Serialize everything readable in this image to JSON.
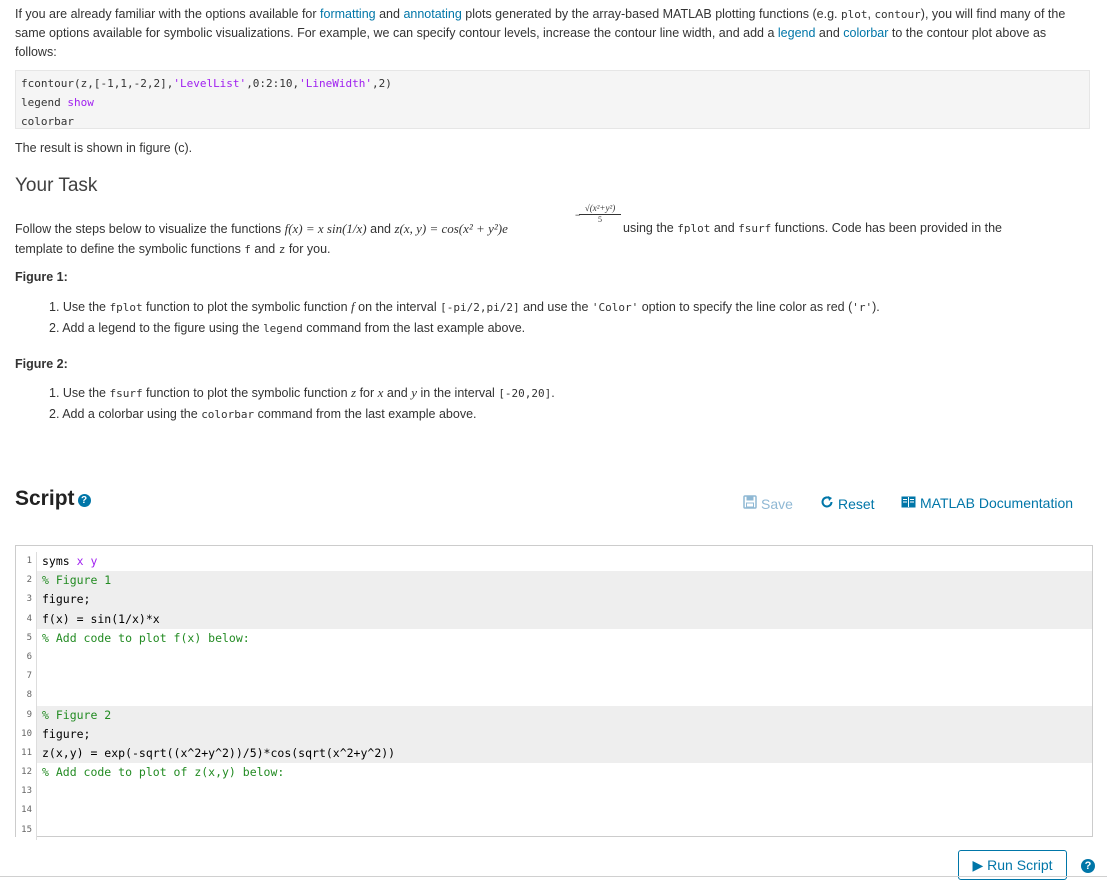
{
  "intro": {
    "p1_a": "If you are already familiar with the options available for ",
    "link_formatting": "formatting",
    "p1_b": " and ",
    "link_annotating": "annotating",
    "p1_c": " plots generated by the array-based MATLAB plotting functions (e.g. ",
    "code_plot": "plot",
    "p1_d": ", ",
    "code_contour": "contour",
    "p1_e": "), you will find many of the same options available for symbolic visualizations. For example, we can specify contour levels, increase the contour line width, and add a ",
    "link_legend": "legend",
    "p1_f": " and ",
    "link_colorbar": "colorbar",
    "p1_g": " to the contour plot above as follows:",
    "code_line1_a": "fcontour(z,[-1,1,-2,2],",
    "code_line1_s1": "'LevelList'",
    "code_line1_b": ",0:2:10,",
    "code_line1_s2": "'LineWidth'",
    "code_line1_c": ",2)",
    "code_line2_a": "legend ",
    "code_line2_b": "show",
    "code_line3": "colorbar",
    "result_text": "The result is shown in figure (c)."
  },
  "task": {
    "heading": "Your Task",
    "follow_a": "Follow the steps below to visualize the functions ",
    "f_def": "f(x) = x sin(1/x)",
    "follow_and": " and ",
    "z_def_a": "z(x, y) = cos(x² + y²)e",
    "z_exp_num": "√(x²+y²)",
    "z_exp_den": "5",
    "follow_b": " using the ",
    "code_fplot": "fplot",
    "follow_c": " and ",
    "code_fsurf": "fsurf",
    "follow_d": " functions. Code has been provided in the",
    "follow_e": "template to define the symbolic functions ",
    "code_f": "f",
    "follow_f": " and ",
    "code_z": "z",
    "follow_g": " for you."
  },
  "figure1": {
    "heading": "Figure 1:",
    "s1_a": "1. Use the ",
    "s1_code1": "fplot",
    "s1_b": " function to plot the symbolic function ",
    "s1_f": "f",
    "s1_c": " on the interval ",
    "s1_code2": "[-pi/2,pi/2]",
    "s1_d": " and use the ",
    "s1_code3": "'Color'",
    "s1_e": " option to specify the line color as red (",
    "s1_code4": "'r'",
    "s1_f2": ").",
    "s2_a": "2. Add a legend to the figure using the ",
    "s2_code": "legend",
    "s2_b": " command from the last example above."
  },
  "figure2": {
    "heading": "Figure 2:",
    "s1_a": "1. Use the ",
    "s1_code1": "fsurf",
    "s1_b": " function to plot the symbolic function ",
    "s1_z": "z",
    "s1_c": " for ",
    "s1_x": "x",
    "s1_d": " and ",
    "s1_y": "y",
    "s1_e": " in the interval ",
    "s1_code2": "[-20,20]",
    "s1_f": ".",
    "s2_a": "2. Add a colorbar using the ",
    "s2_code": "colorbar",
    "s2_b": " command from the last example above."
  },
  "script": {
    "title": "Script",
    "save_label": "Save",
    "reset_label": "Reset",
    "docs_label": "MATLAB Documentation",
    "run_label": "Run Script",
    "lines": [
      {
        "n": "1",
        "a": "syms ",
        "b": "x y",
        "shaded": false
      },
      {
        "n": "2",
        "cmt": "% Figure 1",
        "shaded": true
      },
      {
        "n": "3",
        "a": "figure;",
        "shaded": true
      },
      {
        "n": "4",
        "a": "f(x) = sin(1/x)*x",
        "shaded": true
      },
      {
        "n": "5",
        "cmt": "% Add code to plot f(x) below:",
        "shaded": false
      },
      {
        "n": "6",
        "a": "",
        "shaded": false
      },
      {
        "n": "7",
        "a": "",
        "shaded": false
      },
      {
        "n": "8",
        "a": "",
        "shaded": false
      },
      {
        "n": "9",
        "cmt": "% Figure 2",
        "shaded": true
      },
      {
        "n": "10",
        "a": "figure;",
        "shaded": true
      },
      {
        "n": "11",
        "a": "z(x,y) = exp(-sqrt((x^2+y^2))/5)*cos(sqrt(x^2+y^2))",
        "shaded": true
      },
      {
        "n": "12",
        "cmt": "% Add code to plot of z(x,y) below:",
        "shaded": false
      },
      {
        "n": "13",
        "a": "",
        "shaded": false
      },
      {
        "n": "14",
        "a": "",
        "shaded": false
      },
      {
        "n": "15",
        "a": "",
        "shaded": false
      }
    ]
  },
  "icons": {
    "help": "?",
    "save": "save-disk-icon",
    "reset": "reset-arrow-icon",
    "docs": "documentation-book-icon",
    "run": "play-triangle-icon"
  },
  "colors": {
    "link": "#0076a8",
    "string": "#a020f0",
    "comment": "#228b22",
    "shaded_row": "#eeeeee"
  }
}
